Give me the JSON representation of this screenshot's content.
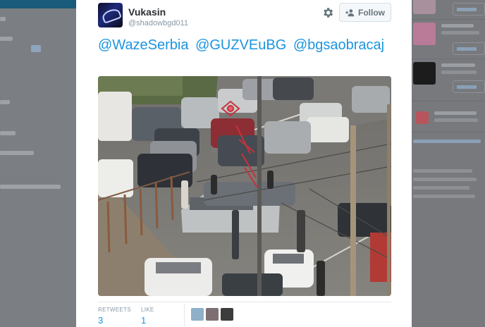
{
  "tweet": {
    "author": {
      "name": "Vukasin",
      "handle": "@shadowbgd011",
      "avatar_icon": "avatar-icon"
    },
    "follow_label": "Follow",
    "mentions": [
      "@WazeSerbia",
      "@GUZVEuBG",
      "@bgsaobracaj"
    ],
    "photo_icon": "traffic-accident-photo",
    "stats": {
      "retweets_label": "RETWEETS",
      "retweets": "3",
      "likes_label": "LIKE",
      "likes": "1"
    }
  },
  "colors": {
    "link": "#1b95e0",
    "name": "#292f33",
    "muted": "#8899a6",
    "overlay": "#6e7175"
  }
}
